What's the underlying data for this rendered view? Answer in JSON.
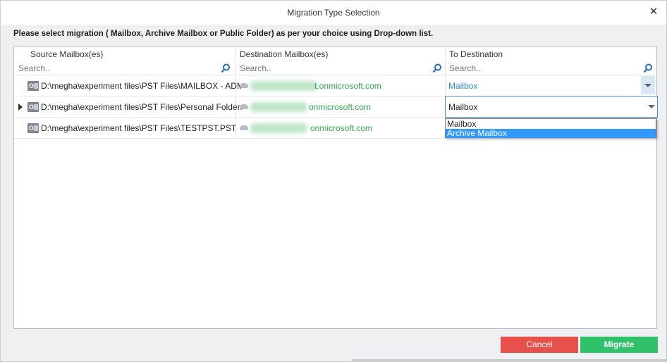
{
  "window": {
    "title": "Migration Type Selection",
    "close_symbol": "✕"
  },
  "instruction": "Please select migration ( Mailbox, Archive Mailbox or Public Folder) as per your choice using Drop-down list.",
  "columns": {
    "source": {
      "header": "Source Mailbox(es)",
      "placeholder": "Search.."
    },
    "destination": {
      "header": "Destination Mailbox(es)",
      "placeholder": "Search.."
    },
    "to_destination": {
      "header": "To Destination",
      "placeholder": "Search.."
    }
  },
  "rows": [
    {
      "source": "D:\\megha\\experiment files\\PST Files\\MAILBOX - ADMI...",
      "destination_suffix": "t.onmicrosoft.com",
      "to_destination": "Mailbox"
    },
    {
      "source": "D:\\megha\\experiment files\\PST Files\\Personal Folders....",
      "destination_suffix": "onmicrosoft.com",
      "to_destination": "Mailbox"
    },
    {
      "source": "D:\\megha\\experiment files\\PST Files\\TESTPST.PST",
      "destination_suffix": "onmicrosoft.com",
      "to_destination": ""
    }
  ],
  "pst_icon_text": "O",
  "dropdown": {
    "options": [
      "Mailbox",
      "Archive Mailbox"
    ],
    "selected_index": 1
  },
  "buttons": {
    "cancel": "Cancel",
    "migrate": "Migrate"
  },
  "colors": {
    "cancel": "#e8504b",
    "migrate": "#2fc26b",
    "email": "#2fa84f",
    "link_value": "#2d8bd0",
    "selection": "#3399ff"
  }
}
